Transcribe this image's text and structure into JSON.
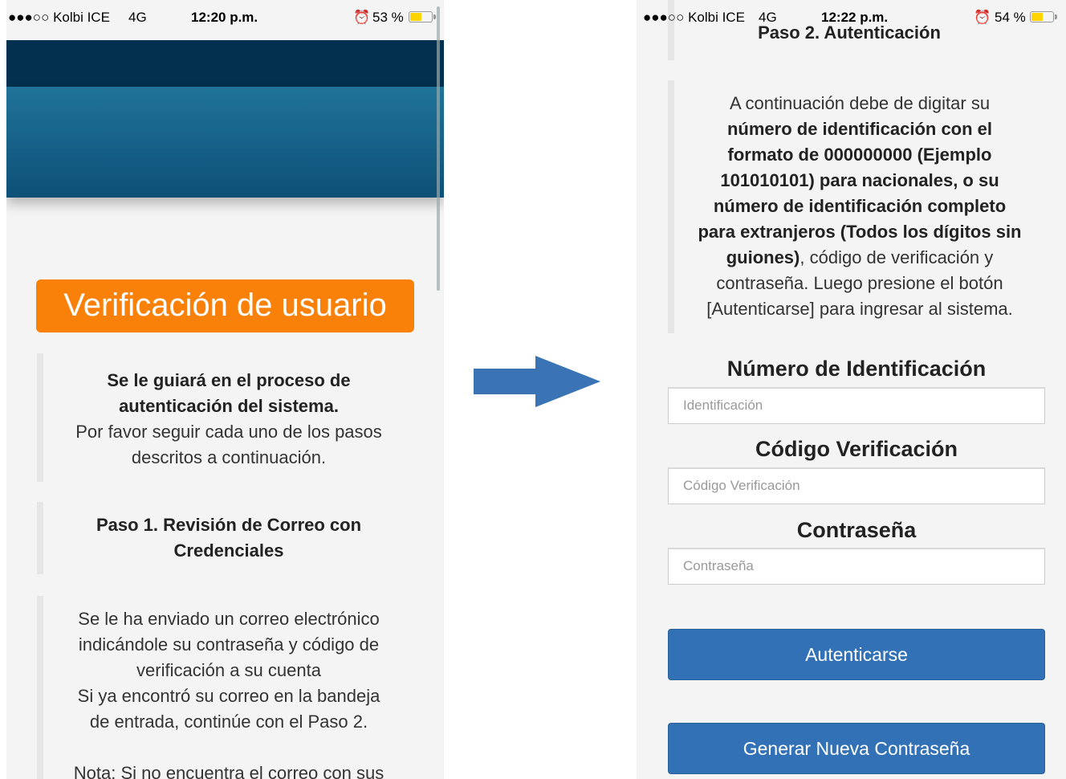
{
  "left": {
    "status": {
      "carrier": "●●●○○ Kolbi ICE",
      "network": "4G",
      "time": "12:20 p.m.",
      "alarm": "⏰",
      "battery_pct": "53 %",
      "battery_level": 0.53
    },
    "title": "Verificación de usuario",
    "intro": {
      "line1": "Se le guiará en el proceso de",
      "line2": "autenticación del sistema.",
      "line3": "Por favor seguir cada uno de los pasos",
      "line4": "descritos a continuación."
    },
    "step1": {
      "line1": "Paso 1. Revisión de Correo con",
      "line2": "Credenciales"
    },
    "step1_body": {
      "line1": "Se le ha enviado un correo electrónico",
      "line2": "indicándole su contraseña y código de",
      "line3": "verificación a su cuenta",
      "line4": "Si ya encontró su correo en la bandeja",
      "line5": "de entrada, continúe con el Paso 2.",
      "line6": "Nota: Si no encuentra el correo con sus"
    }
  },
  "right": {
    "status": {
      "carrier": "●●●○○ Kolbi ICE",
      "network": "4G",
      "time": "12:22 p.m.",
      "alarm": "⏰",
      "battery_pct": "54 %",
      "battery_level": 0.54
    },
    "step2": "Paso 2. Autenticación",
    "instructions": {
      "p1": "A continuación debe de digitar su",
      "b1": "número de identificación con el",
      "b2": "formato de ",
      "n1": "000000000",
      "b3": " (Ejemplo",
      "n2": "101010101",
      "b4": ") para nacionales, o su",
      "b5": "número de identificación completo",
      "b6": "para extranjeros (Todos los dígitos sin",
      "b7": "guiones)",
      "p2": ", código de verificación y",
      "p3": "contraseña. Luego presione el botón",
      "p4": "[Autenticarse] para ingresar al sistema."
    },
    "form": {
      "id_label": "Número de Identificación",
      "id_placeholder": "Identificación",
      "code_label": "Código Verificación",
      "code_placeholder": "Código Verificación",
      "pass_label": "Contraseña",
      "pass_placeholder": "Contraseña"
    },
    "buttons": {
      "auth": "Autenticarse",
      "new_password": "Generar Nueva Contraseña"
    }
  },
  "colors": {
    "badge": "#f98109",
    "nav": "#04304f",
    "banner": "#1c6b91",
    "button": "#3271b5",
    "highlight": "#337ab7",
    "arrow": "#3a74b4"
  }
}
